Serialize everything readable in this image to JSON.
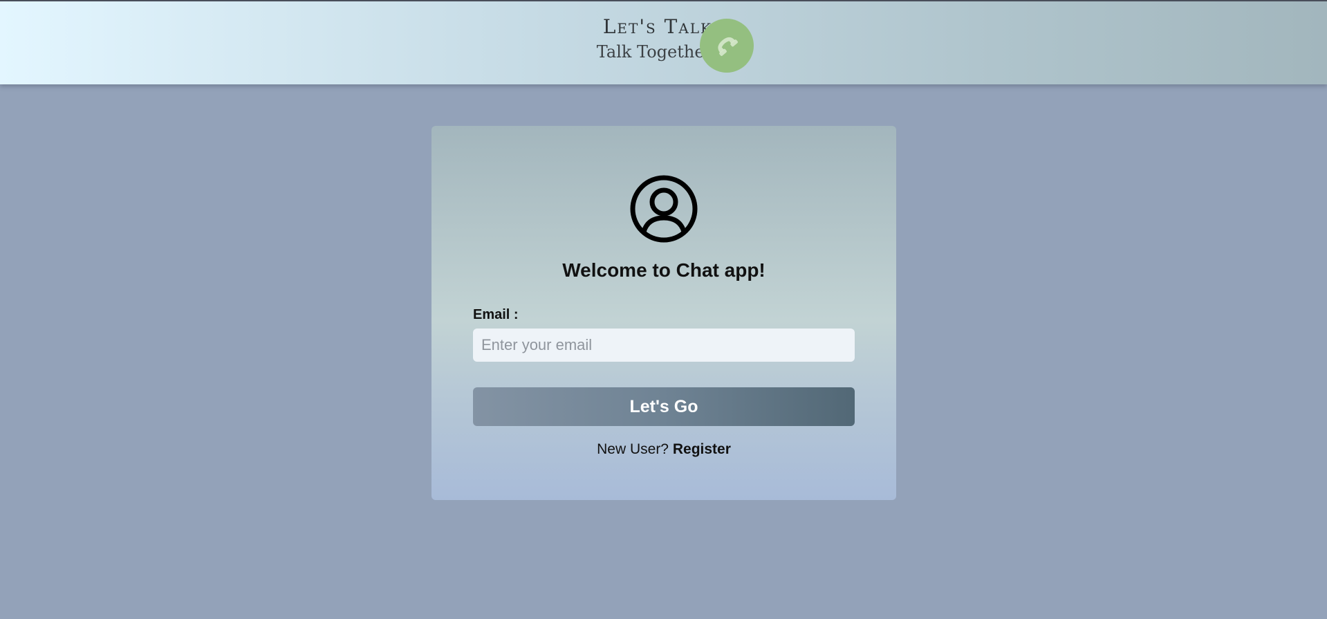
{
  "header": {
    "brand_title": "Let's Talk",
    "brand_tagline": "Talk Together",
    "logo_icon": "phone-icon",
    "logo_color": "#94bf80"
  },
  "login": {
    "avatar_icon": "user-circle-icon",
    "welcome": "Welcome to Chat app!",
    "email_label": "Email :",
    "email_placeholder": "Enter your email",
    "email_value": "",
    "submit_label": "Let's Go",
    "register_prompt": "New User?",
    "register_link": "Register"
  },
  "colors": {
    "page_background": "#93a2b9",
    "button_gradient_start": "#8393a4",
    "button_gradient_end": "#526876"
  }
}
